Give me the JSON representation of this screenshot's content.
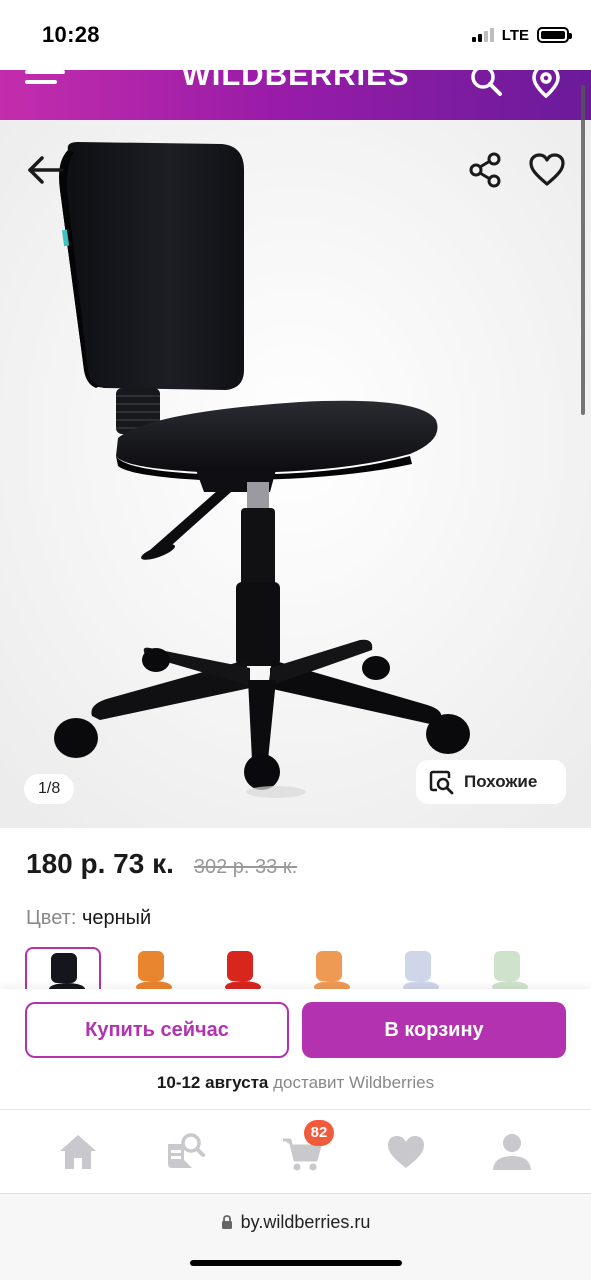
{
  "status_bar": {
    "time": "10:28",
    "network": "LTE",
    "signal_bars": 2,
    "signal_bars_total": 4,
    "battery_level": 0.9
  },
  "header": {
    "brand": "WILDBERRIES",
    "menu_icon": "hamburger-menu-icon",
    "search_icon": "search-icon",
    "location_icon": "map-pin-icon",
    "gradient_start": "#c32dac",
    "gradient_end": "#6a1b9a"
  },
  "gallery": {
    "counter": "1/8",
    "similar_label": "Похожие",
    "back_icon": "arrow-left-icon",
    "share_icon": "share-icon",
    "favorite_icon": "heart-outline-icon",
    "similar_icon": "image-search-icon"
  },
  "product": {
    "price": "180 р. 73 к.",
    "old_price": "302 р. 33 к.",
    "color_label": "Цвет:",
    "color_value": "черный",
    "color_variants": [
      {
        "name": "black",
        "color": "#15161b",
        "selected": true
      },
      {
        "name": "orange",
        "color": "#e9842f",
        "selected": false
      },
      {
        "name": "red",
        "color": "#d8261f",
        "selected": false
      },
      {
        "name": "light-orange",
        "color": "#ee9a55",
        "selected": false
      },
      {
        "name": "light-blue",
        "color": "#cfd6ea",
        "selected": false
      },
      {
        "name": "mint",
        "color": "#cfe3cc",
        "selected": false
      }
    ]
  },
  "actions": {
    "buy_now": "Купить сейчас",
    "add_to_cart": "В корзину",
    "delivery_date": "10-12 августа",
    "delivery_text": " доставит Wildberries"
  },
  "tabbar": {
    "items": [
      {
        "name": "home",
        "icon": "home-icon"
      },
      {
        "name": "catalog",
        "icon": "catalog-search-icon"
      },
      {
        "name": "cart",
        "icon": "cart-icon"
      },
      {
        "name": "favorites",
        "icon": "heart-icon"
      },
      {
        "name": "profile",
        "icon": "user-icon"
      }
    ],
    "cart_badge": "82"
  },
  "browser": {
    "url": "by.wildberries.ru"
  },
  "colors": {
    "accent": "#b232b0",
    "badge": "#f25a3c",
    "muted": "#888888"
  }
}
